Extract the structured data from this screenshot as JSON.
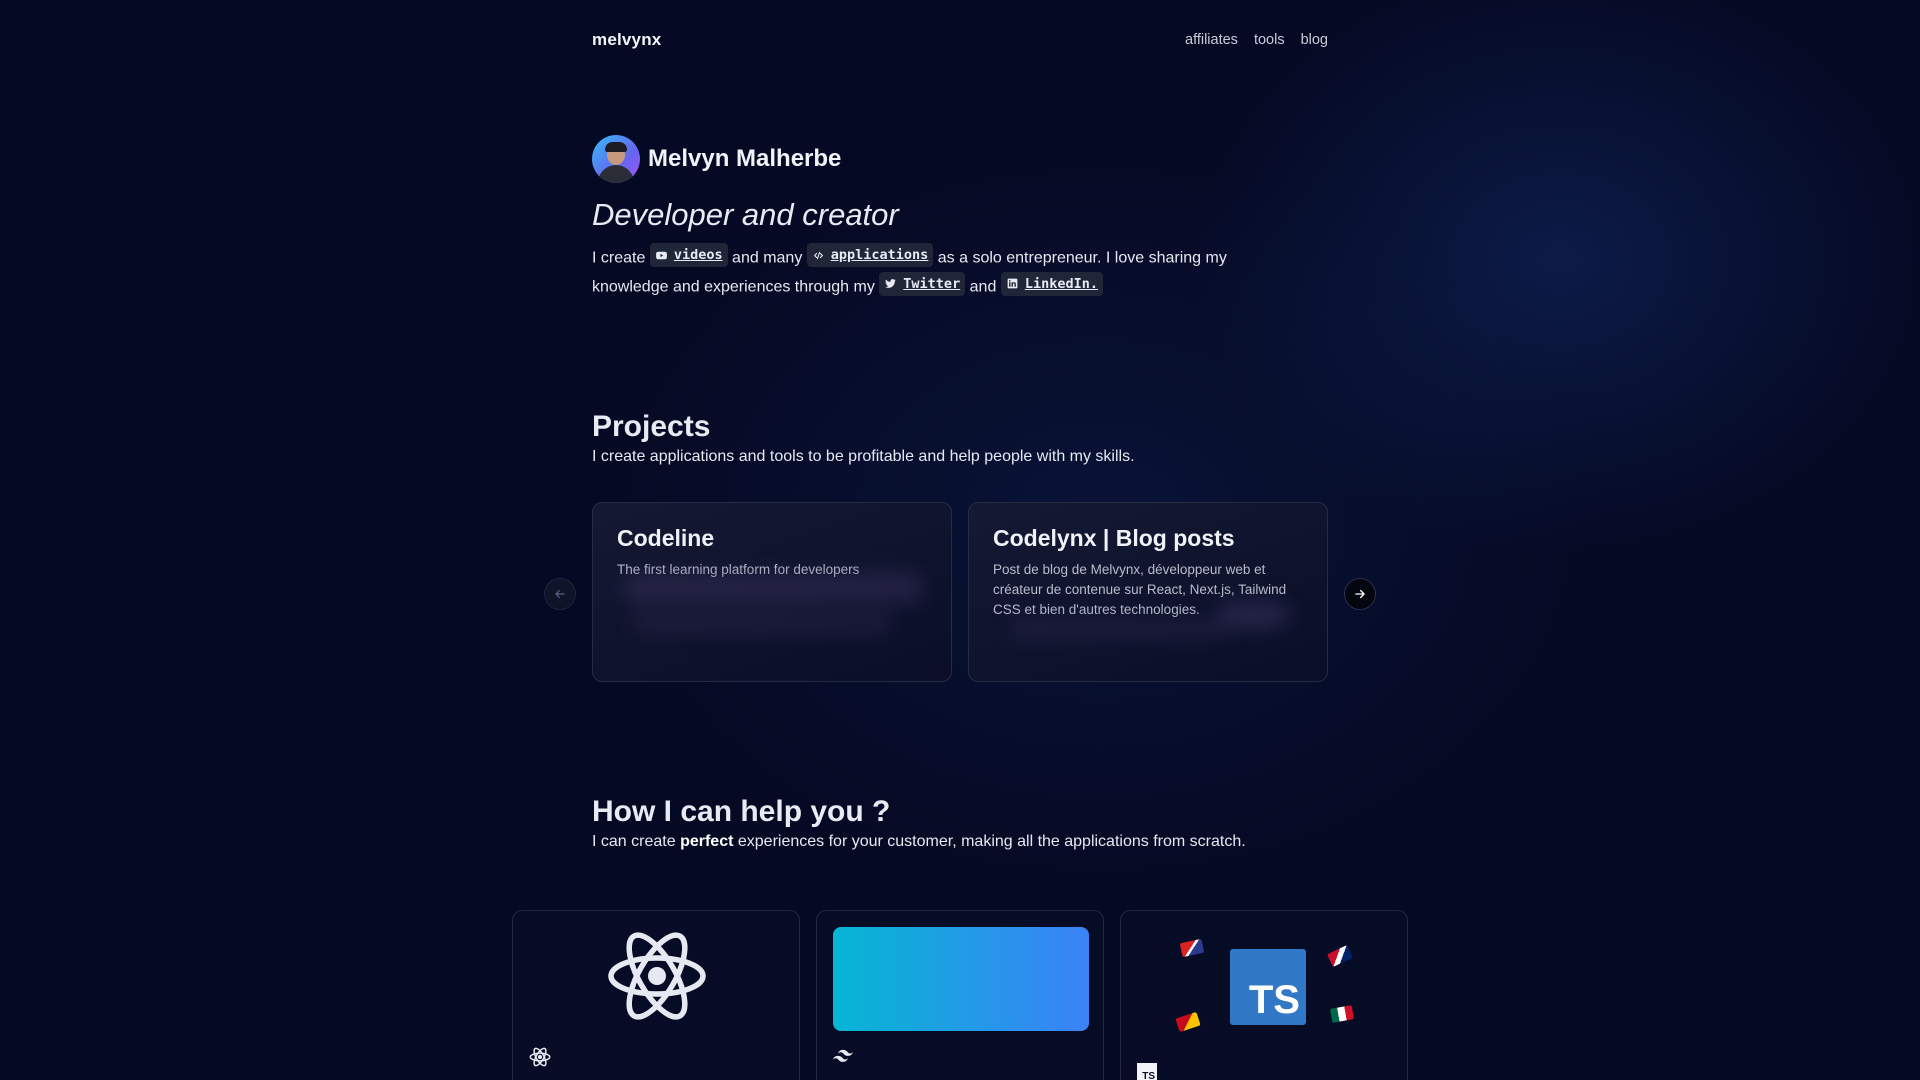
{
  "nav": {
    "logo": "melvynx",
    "links": [
      "affiliates",
      "tools",
      "blog"
    ]
  },
  "hero": {
    "name": "Melvyn Malherbe",
    "tagline": "Developer and creator",
    "intro": {
      "t1": "I create",
      "chip_videos": "videos",
      "t2": "and many",
      "chip_applications": "applications",
      "t3": "as a solo entrepreneur. I love sharing my knowledge and experiences through my",
      "chip_twitter": "Twitter",
      "t4": "and",
      "chip_linkedin": "LinkedIn."
    }
  },
  "projects": {
    "title": "Projects",
    "subtitle": "I create applications and tools to be profitable and help people with my skills.",
    "cards": [
      {
        "title": "Codeline",
        "description": "The first learning platform for developers"
      },
      {
        "title": "Codelynx | Blog posts",
        "description": "Post de blog de Melvynx, développeur web et créateur de contenue sur React, Next.js, Tailwind CSS et bien d'autres technologies."
      }
    ]
  },
  "help": {
    "title": "How I can help you ?",
    "subtitle_pre": "I can create",
    "subtitle_bold": "perfect",
    "subtitle_post": "experiences for your customer, making all the applications from scratch.",
    "tiles": [
      {
        "icon": "react-icon"
      },
      {
        "icon": "tailwind-icon"
      },
      {
        "icon": "typescript-icon",
        "logo_text": "TS",
        "small_logo_text": "TS"
      }
    ]
  },
  "colors": {
    "background": "#050a24",
    "card_border": "#262c45",
    "chip_bg": "#1f2638",
    "tailwind_gradient_start": "#06b6d4",
    "tailwind_gradient_end": "#3b82f6",
    "typescript_blue": "#3178c6"
  }
}
